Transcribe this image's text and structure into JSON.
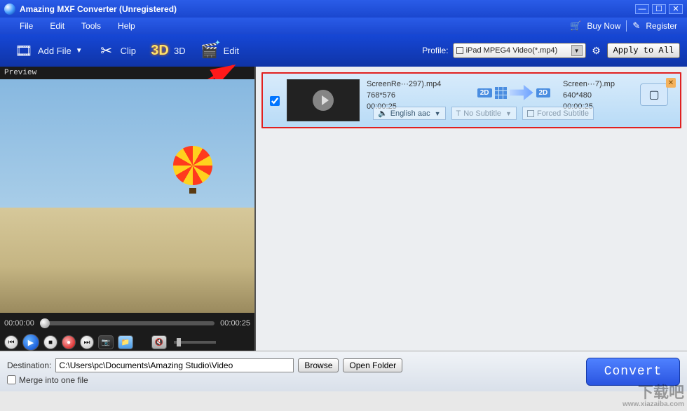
{
  "window": {
    "title": "Amazing MXF Converter (Unregistered)"
  },
  "menubar": {
    "items": [
      "File",
      "Edit",
      "Tools",
      "Help"
    ],
    "buy_now": "Buy Now",
    "register": "Register"
  },
  "toolbar": {
    "add_file": "Add File",
    "clip": "Clip",
    "three_d": "3D",
    "three_d_icon": "3D",
    "edit": "Edit",
    "profile_label": "Profile:",
    "profile_value": "iPad MPEG4 Video(*.mp4)",
    "apply_all": "Apply to All"
  },
  "preview": {
    "title": "Preview",
    "time_current": "00:00:00",
    "time_total": "00:00:25"
  },
  "item": {
    "checked": true,
    "src": {
      "name": "ScreenRe···297).mp4",
      "res": "768*576",
      "dur": "00:00:25"
    },
    "dst": {
      "name": "Screen···7).mp",
      "res": "640*480",
      "dur": "00:00:25"
    },
    "badge_src": "2D",
    "badge_dst": "2D",
    "audio": "English aac",
    "subtitle": "No Subtitle",
    "forced": "Forced Subtitle"
  },
  "bottom": {
    "dest_label": "Destination:",
    "dest_path": "C:\\Users\\pc\\Documents\\Amazing Studio\\Video",
    "browse": "Browse",
    "open_folder": "Open Folder",
    "merge": "Merge into one file",
    "convert": "Convert"
  },
  "watermark": {
    "big": "下载吧",
    "url": "www.xiazaiba.com"
  }
}
